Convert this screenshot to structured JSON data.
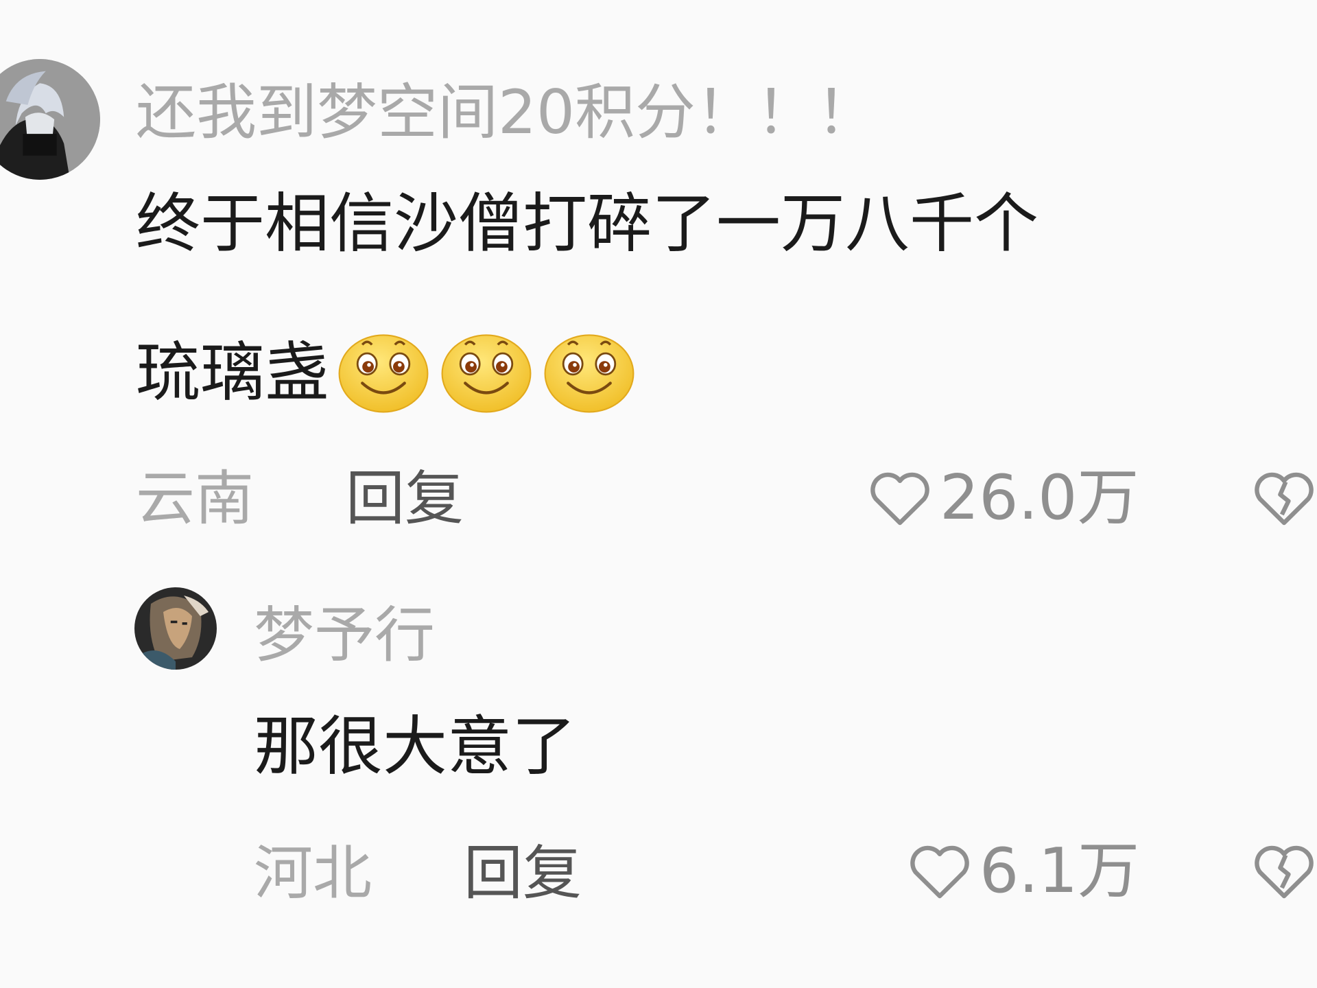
{
  "comments": [
    {
      "username": "还我到梦空间20积分！！！",
      "content_line1": "终于相信沙僧打碎了一万八千个",
      "content_line2": "琉璃盏",
      "emojis": [
        "smile-emoji",
        "smile-emoji",
        "smile-emoji"
      ],
      "location": "云南",
      "reply_label": "回复",
      "like_count": "26.0万",
      "like_icon": "heart-outline-icon",
      "dislike_icon": "broken-heart-icon"
    },
    {
      "username": "梦予行",
      "content": "那很大意了",
      "location": "河北",
      "reply_label": "回复",
      "like_count": "6.1万",
      "like_icon": "heart-outline-icon",
      "dislike_icon": "broken-heart-icon"
    }
  ],
  "colors": {
    "background": "#fafafa",
    "username": "#a9a9a9",
    "content": "#1b1b1b",
    "meta": "#a9a9a9",
    "reply": "#555555",
    "icon": "#8f8f8f",
    "emoji_face": "#f7d13a"
  }
}
